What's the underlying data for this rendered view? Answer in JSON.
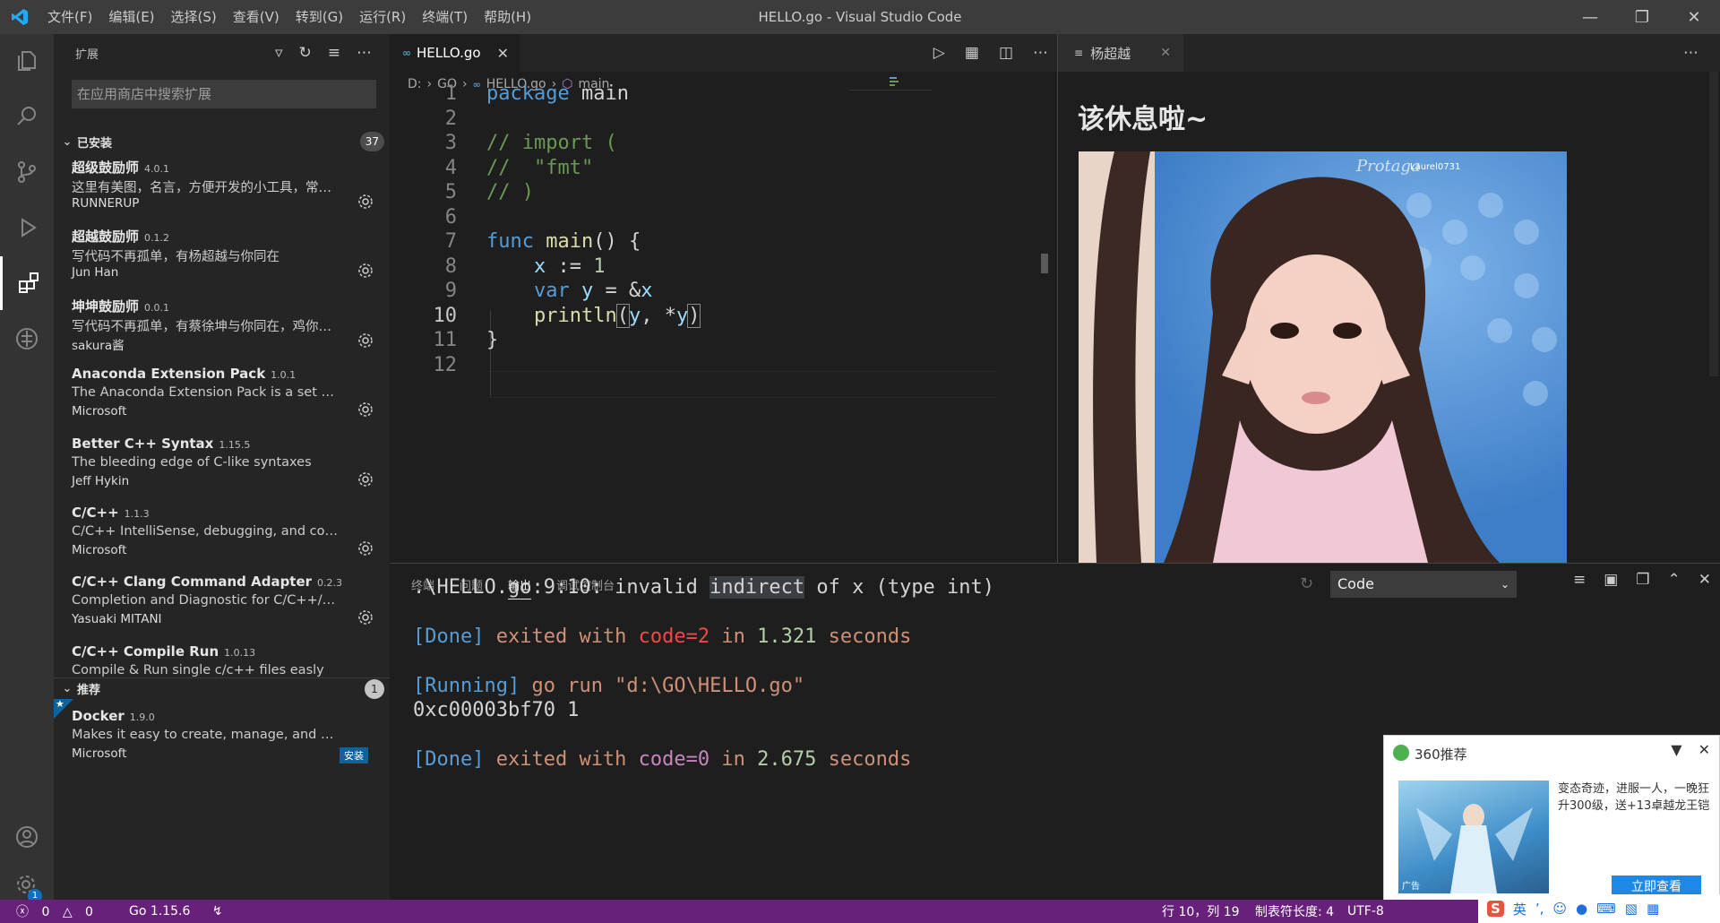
{
  "window": {
    "title": "HELLO.go - Visual Studio Code",
    "menu": [
      "文件(F)",
      "编辑(E)",
      "选择(S)",
      "查看(V)",
      "转到(G)",
      "运行(R)",
      "终端(T)",
      "帮助(H)"
    ]
  },
  "sidebar": {
    "title": "扩展",
    "search_placeholder": "在应用商店中搜索扩展",
    "installed_label": "已安装",
    "installed_count": "37",
    "extensions": [
      {
        "name": "超级鼓励师",
        "version": "4.0.1",
        "desc": "这里有美图，名言，方便开发的小工具，常见...",
        "publisher": "RUNNERUP"
      },
      {
        "name": "超越鼓励师",
        "version": "0.1.2",
        "desc": "写代码不再孤单，有杨超越与你同在",
        "publisher": "Jun Han"
      },
      {
        "name": "坤坤鼓励师",
        "version": "0.0.1",
        "desc": "写代码不再孤单，有蔡徐坤与你同在，鸡你太...",
        "publisher": "sakura酱"
      },
      {
        "name": "Anaconda Extension Pack",
        "version": "1.0.1",
        "desc": "The Anaconda Extension Pack is a set of exten...",
        "publisher": "Microsoft"
      },
      {
        "name": "Better C++ Syntax",
        "version": "1.15.5",
        "desc": "The bleeding edge of C-like syntaxes",
        "publisher": "Jeff Hykin"
      },
      {
        "name": "C/C++",
        "version": "1.1.3",
        "desc": "C/C++ IntelliSense, debugging, and code bro...",
        "publisher": "Microsoft"
      },
      {
        "name": "C/C++ Clang Command Adapter",
        "version": "0.2.3",
        "desc": "Completion and Diagnostic for C/C++/Object...",
        "publisher": "Yasuaki MITANI"
      },
      {
        "name": "C/C++ Compile Run",
        "version": "1.0.13",
        "desc": "Compile & Run single c/c++ files easly",
        "publisher": ""
      }
    ],
    "recommended_label": "推荐",
    "recommended_count": "1",
    "recommended": [
      {
        "name": "Docker",
        "version": "1.9.0",
        "desc": "Makes it easy to create, manage, and debug c...",
        "publisher": "Microsoft",
        "install_label": "安装"
      }
    ]
  },
  "editor": {
    "tab_label": "HELLO.go",
    "breadcrumb": [
      "D:",
      "GO",
      "HELLO.go",
      "main"
    ],
    "line_numbers": [
      "1",
      "2",
      "3",
      "4",
      "5",
      "6",
      "7",
      "8",
      "9",
      "10",
      "11",
      "12"
    ],
    "current_line": "10"
  },
  "preview": {
    "tab_label": "杨超越",
    "heading": "该休息啦~",
    "photo_watermark": "Laurel0731"
  },
  "panel": {
    "tabs": [
      "终端",
      "问题",
      "输出",
      "调试控制台"
    ],
    "active_tab": "输出",
    "channel": "Code",
    "output": {
      "l1a": ".\\HELLO.go:9:10: invalid ",
      "l1b": "indirect",
      "l1c": " of x (type int)",
      "done1_tag": "[Done]",
      "done1_a": " exited with ",
      "done1_code": "code=2",
      "done1_b": " in ",
      "done1_t": "1.321",
      "done1_c": " seconds",
      "run_tag": "[Running]",
      "run_cmd": " go run \"d:\\GO\\HELLO.go\"",
      "result": "0xc00003bf70 1",
      "done2_tag": "[Done]",
      "done2_a": " exited with ",
      "done2_code": "code=0",
      "done2_b": " in ",
      "done2_t": "2.675",
      "done2_c": " seconds"
    }
  },
  "popup": {
    "title": "360推荐",
    "text": "变态奇迹，进服一人，一晚狂升300级，送+13卓越龙王铠",
    "button": "立即查看",
    "ad_label": "广告"
  },
  "statusbar": {
    "errors": "0",
    "warnings": "0",
    "go_version": "Go 1.15.6",
    "position": "行 10，列 19",
    "tab_size": "制表符长度: 4",
    "encoding": "UTF-8",
    "notification_count": "1"
  },
  "ime": {
    "lang": "英"
  }
}
